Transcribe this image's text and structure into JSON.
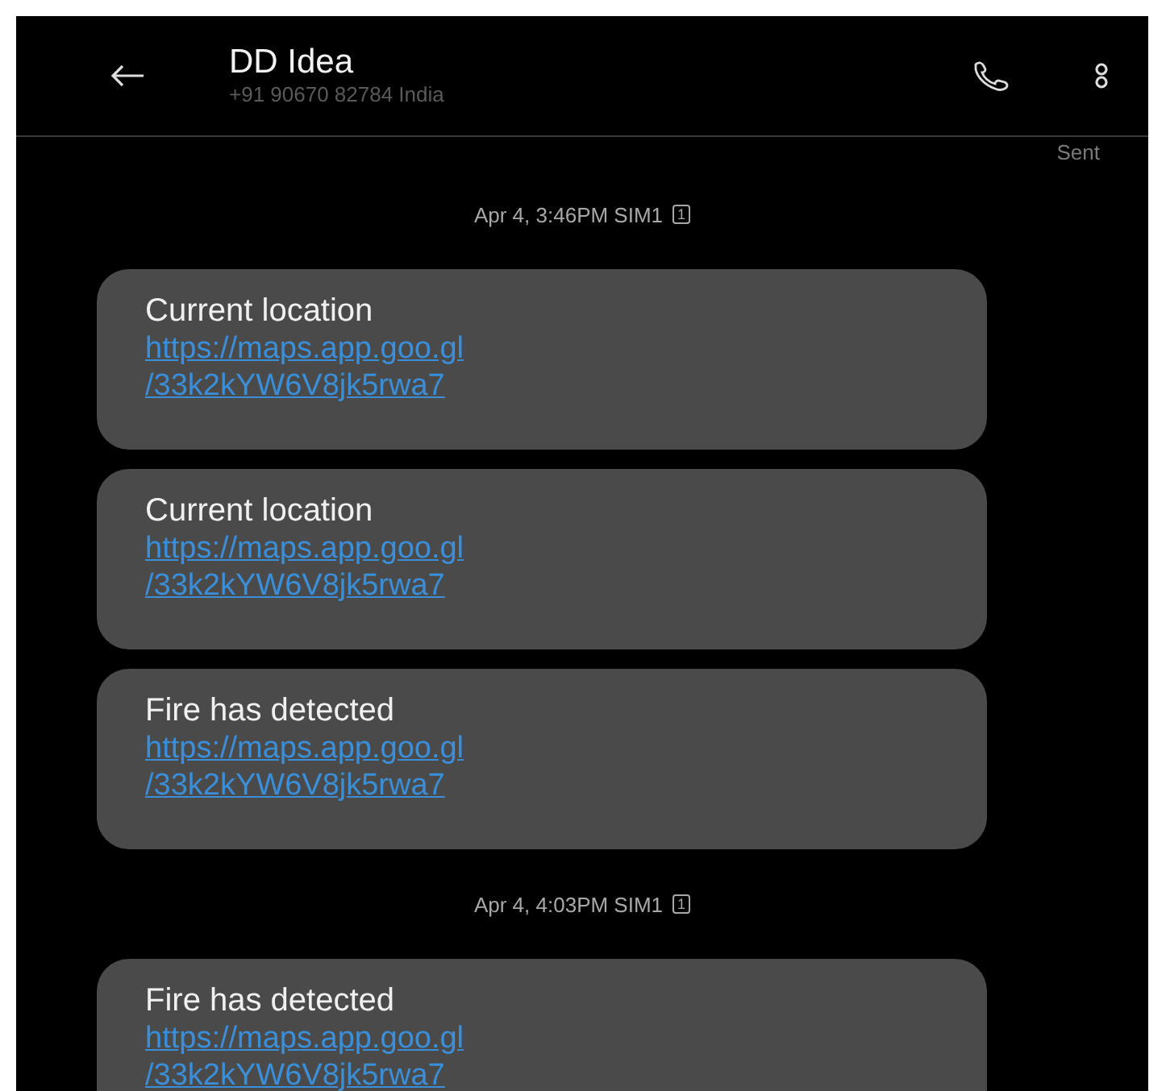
{
  "header": {
    "title": "DD Idea",
    "subtitle": "+91 90670 82784  India"
  },
  "status": "Sent",
  "thread": [
    {
      "kind": "time",
      "text": "Apr 4, 3:46PM  SIM1",
      "sim": "1"
    },
    {
      "kind": "message",
      "text": "Current location",
      "link": [
        "https://maps.app.goo.gl",
        "/33k2kYW6V8jk5rwa7"
      ]
    },
    {
      "kind": "message",
      "text": "Current location",
      "link": [
        "https://maps.app.goo.gl",
        "/33k2kYW6V8jk5rwa7"
      ]
    },
    {
      "kind": "message",
      "text": "Fire has detected",
      "link": [
        "https://maps.app.goo.gl",
        "/33k2kYW6V8jk5rwa7"
      ]
    },
    {
      "kind": "time",
      "text": "Apr 4, 4:03PM  SIM1",
      "sim": "1"
    },
    {
      "kind": "message",
      "text": "Fire has detected",
      "link": [
        "https://maps.app.goo.gl",
        "/33k2kYW6V8jk5rwa7"
      ]
    }
  ]
}
